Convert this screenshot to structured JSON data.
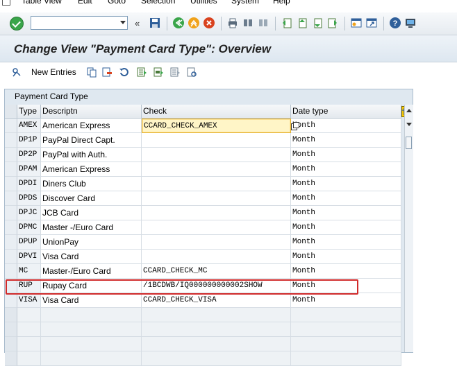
{
  "menu": {
    "items": [
      "Table View",
      "Edit",
      "Goto",
      "Selection",
      "Utilities",
      "System",
      "Help"
    ]
  },
  "toolbar": {
    "command_field_value": "",
    "icons": [
      "enter-icon",
      "save-icon",
      "back-icon",
      "exit-icon",
      "cancel-icon",
      "print-icon",
      "find-icon",
      "find-next-icon",
      "first-page-icon",
      "previous-page-icon",
      "next-page-icon",
      "last-page-icon",
      "create-session-icon",
      "shortcut-icon",
      "help-icon",
      "customize-layout-icon"
    ]
  },
  "title": "Change View \"Payment Card Type\": Overview",
  "app_toolbar": {
    "new_entries_label": "New Entries"
  },
  "table": {
    "caption": "Payment Card Type",
    "columns": [
      "Type",
      "Descriptn",
      "Check",
      "Date type"
    ],
    "rows": [
      {
        "type": "AMEX",
        "desc": "American Express",
        "check": "CCARD_CHECK_AMEX",
        "date": "Month"
      },
      {
        "type": "DP1P",
        "desc": "PayPal Direct Capt.",
        "check": "",
        "date": "Month"
      },
      {
        "type": "DP2P",
        "desc": "PayPal with Auth.",
        "check": "",
        "date": "Month"
      },
      {
        "type": "DPAM",
        "desc": "American Express",
        "check": "",
        "date": "Month"
      },
      {
        "type": "DPDI",
        "desc": "Diners Club",
        "check": "",
        "date": "Month"
      },
      {
        "type": "DPDS",
        "desc": "Discover Card",
        "check": "",
        "date": "Month"
      },
      {
        "type": "DPJC",
        "desc": "JCB Card",
        "check": "",
        "date": "Month"
      },
      {
        "type": "DPMC",
        "desc": "Master -/Euro Card",
        "check": "",
        "date": "Month"
      },
      {
        "type": "DPUP",
        "desc": "UnionPay",
        "check": "",
        "date": "Month"
      },
      {
        "type": "DPVI",
        "desc": "Visa Card",
        "check": "",
        "date": "Month"
      },
      {
        "type": "MC",
        "desc": "Master-/Euro Card",
        "check": "CCARD_CHECK_MC",
        "date": "Month"
      },
      {
        "type": "RUP",
        "desc": "Rupay Card",
        "check": "/1BCDWB/IQ000000000002SHOW",
        "date": "Month"
      },
      {
        "type": "VISA",
        "desc": "Visa Card",
        "check": "CCARD_CHECK_VISA",
        "date": "Month"
      }
    ]
  },
  "colors": {
    "highlight": "#d12a2a",
    "focus": "#fff5c7"
  }
}
